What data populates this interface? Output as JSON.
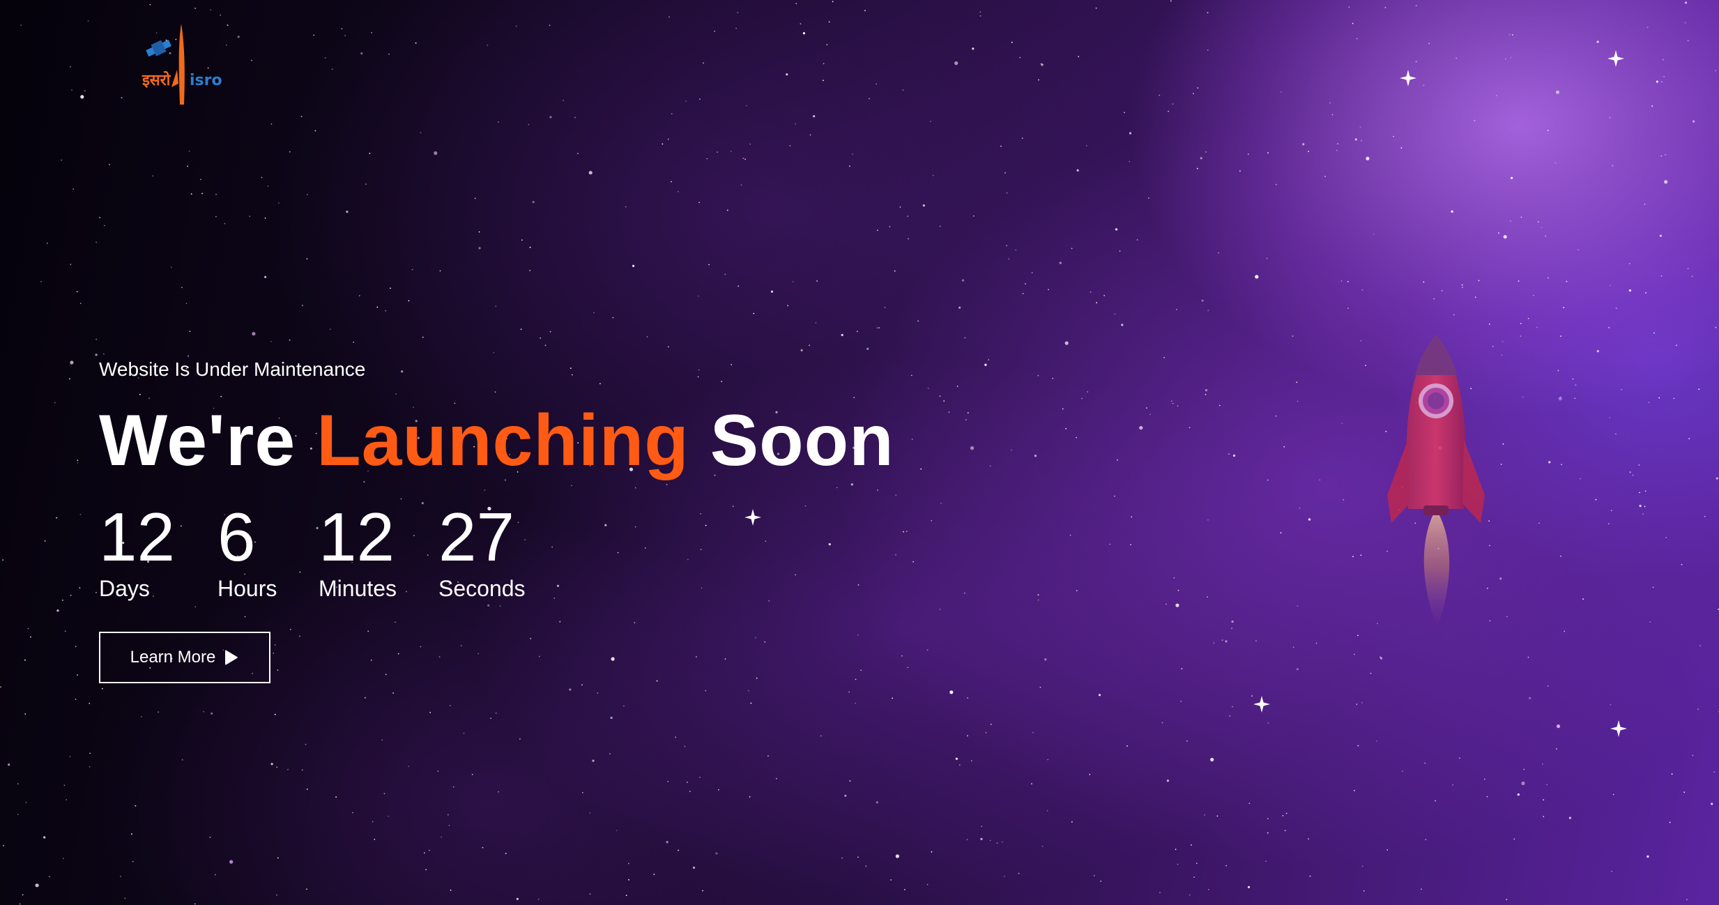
{
  "logo": {
    "hindi_text": "इसरो",
    "latin_text": "isro"
  },
  "hero": {
    "subtitle": "Website Is Under Maintenance",
    "headline_part1": "We're ",
    "headline_accent": "Launching",
    "headline_part2": " Soon"
  },
  "countdown": {
    "days": {
      "value": "12",
      "label": "Days"
    },
    "hours": {
      "value": "6",
      "label": "Hours"
    },
    "minutes": {
      "value": "12",
      "label": "Minutes"
    },
    "seconds": {
      "value": "27",
      "label": "Seconds"
    }
  },
  "cta": {
    "label": "Learn More",
    "icon": "play-icon"
  },
  "colors": {
    "accent": "#ff5b14",
    "text": "#ffffff",
    "background_dark": "#07030f",
    "background_purple": "#5a24a0"
  }
}
